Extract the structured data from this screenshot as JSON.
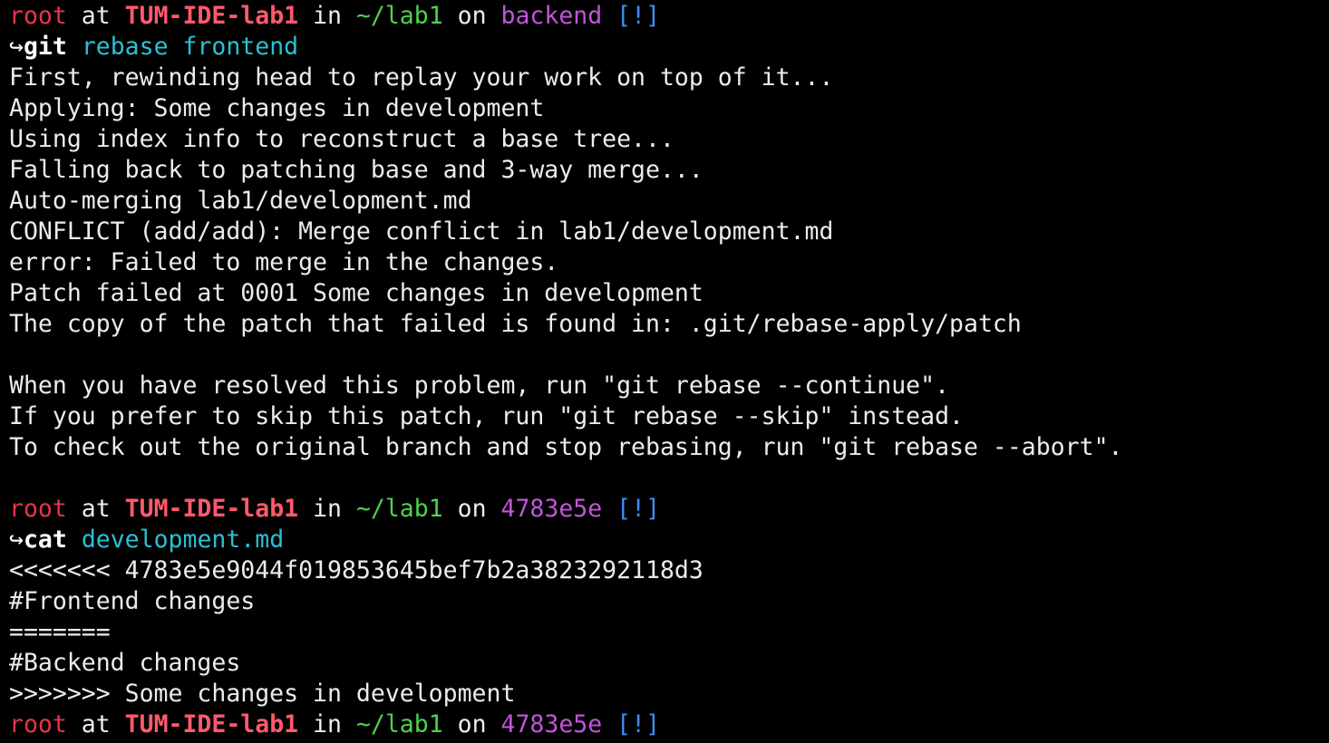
{
  "prompts": [
    {
      "user": "root",
      "at": " at ",
      "host": "TUM-IDE-lab1",
      "in": " in ",
      "path": "~/lab1",
      "on": " on ",
      "branch": "backend",
      "status": "[!]"
    },
    {
      "user": "root",
      "at": " at ",
      "host": "TUM-IDE-lab1",
      "in": " in ",
      "path": "~/lab1",
      "on": " on ",
      "branch": "4783e5e",
      "status": "[!]"
    },
    {
      "user": "root",
      "at": " at ",
      "host": "TUM-IDE-lab1",
      "in": " in ",
      "path": "~/lab1",
      "on": " on ",
      "branch": "4783e5e",
      "status": "[!]"
    }
  ],
  "commands": [
    {
      "arrow": "↪",
      "name": "git",
      "args": "rebase frontend"
    },
    {
      "arrow": "↪",
      "name": "cat",
      "args": "development.md"
    }
  ],
  "output1": [
    "First, rewinding head to replay your work on top of it...",
    "Applying: Some changes in development",
    "Using index info to reconstruct a base tree...",
    "Falling back to patching base and 3-way merge...",
    "Auto-merging lab1/development.md",
    "CONFLICT (add/add): Merge conflict in lab1/development.md",
    "error: Failed to merge in the changes.",
    "Patch failed at 0001 Some changes in development",
    "The copy of the patch that failed is found in: .git/rebase-apply/patch",
    "",
    "When you have resolved this problem, run \"git rebase --continue\".",
    "If you prefer to skip this patch, run \"git rebase --skip\" instead.",
    "To check out the original branch and stop rebasing, run \"git rebase --abort\".",
    ""
  ],
  "output2": [
    "<<<<<<< 4783e5e9044f019853645bef7b2a3823292118d3",
    "#Frontend changes",
    "=======",
    "#Backend changes",
    ">>>>>>> Some changes in development"
  ],
  "colors": {
    "background": "#000000",
    "text": "#ececec",
    "user": "#e8344a",
    "host": "#ff5a6c",
    "path": "#4fd150",
    "branch": "#c254d8",
    "status": "#3e8ff5",
    "command_arg": "#2bc0d3"
  }
}
